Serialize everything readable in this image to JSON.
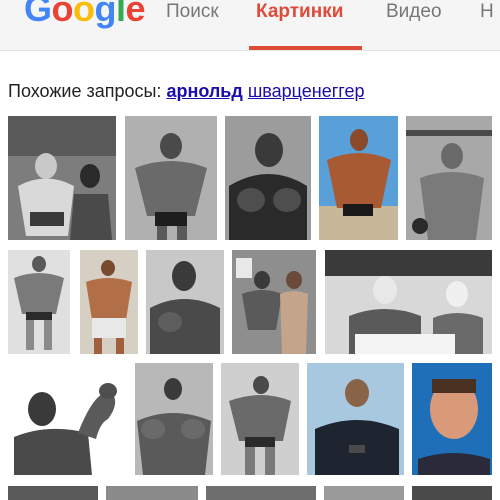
{
  "logo": {
    "letters": [
      {
        "ch": "G",
        "color": "#4285f4"
      },
      {
        "ch": "o",
        "color": "#ea4335"
      },
      {
        "ch": "o",
        "color": "#fbbc05"
      },
      {
        "ch": "g",
        "color": "#4285f4"
      },
      {
        "ch": "l",
        "color": "#34a853"
      },
      {
        "ch": "e",
        "color": "#ea4335"
      }
    ]
  },
  "tabs": [
    {
      "label": "Поиск",
      "active": false
    },
    {
      "label": "Картинки",
      "active": true
    },
    {
      "label": "Видео",
      "active": false
    },
    {
      "label": "Н",
      "active": false
    }
  ],
  "related": {
    "prefix": "Похожие запросы: ",
    "bold_link": "арнольд",
    "link": "шварценеггер"
  },
  "accent_color": "#dd4b39",
  "link_color": "#1a0dab",
  "image_grid": {
    "rows": 4,
    "thumbnail_count": 18
  }
}
